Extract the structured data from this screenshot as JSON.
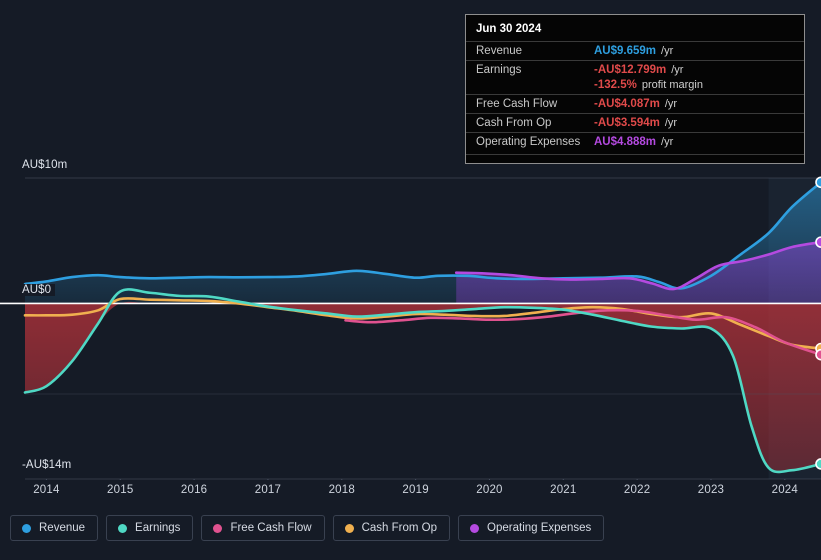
{
  "chart_data": {
    "type": "area",
    "title": "",
    "xlabel": "",
    "ylabel": "",
    "currency": "AU$",
    "y_axis": {
      "top_label": "AU$10m",
      "zero_label": "AU$0",
      "bottom_label": "-AU$14m",
      "ylim": [
        -14,
        10
      ],
      "gridlines": [
        10,
        0,
        -14
      ]
    },
    "x_axis": {
      "ticks": [
        "2014",
        "2015",
        "2016",
        "2017",
        "2018",
        "2019",
        "2020",
        "2021",
        "2022",
        "2023",
        "2024"
      ],
      "xlim": [
        2013.71,
        2024.49
      ]
    },
    "legend_position": "bottom-left",
    "grid": true,
    "forecast_boundary_year": 2023.78,
    "series": [
      {
        "name": "Revenue",
        "color": "#2e9fe0",
        "fill": "#1d4a66",
        "x": [
          2013.71,
          2014.0,
          2014.35,
          2014.7,
          2015.0,
          2015.4,
          2015.8,
          2016.2,
          2016.6,
          2017.0,
          2017.4,
          2017.8,
          2018.2,
          2018.6,
          2019.0,
          2019.3,
          2019.7,
          2020.1,
          2020.5,
          2021.0,
          2021.5,
          2022.0,
          2022.3,
          2022.6,
          2023.0,
          2023.4,
          2023.78,
          2024.1,
          2024.49
        ],
        "values": [
          1.55,
          1.75,
          2.1,
          2.25,
          2.1,
          2.0,
          2.05,
          2.1,
          2.08,
          2.1,
          2.15,
          2.35,
          2.6,
          2.35,
          2.05,
          2.2,
          2.2,
          2.0,
          1.95,
          2.0,
          2.05,
          2.15,
          1.7,
          1.2,
          2.2,
          3.9,
          5.6,
          7.7,
          9.659
        ]
      },
      {
        "name": "Earnings",
        "color": "#4fd8c4",
        "fill": "#8a2b33",
        "x": [
          2013.71,
          2014.0,
          2014.35,
          2014.7,
          2015.0,
          2015.4,
          2015.8,
          2016.2,
          2016.6,
          2017.0,
          2017.4,
          2017.8,
          2018.2,
          2018.6,
          2019.0,
          2019.4,
          2019.8,
          2020.2,
          2020.6,
          2021.0,
          2021.4,
          2021.8,
          2022.2,
          2022.6,
          2023.0,
          2023.3,
          2023.55,
          2023.78,
          2024.1,
          2024.49
        ],
        "values": [
          -7.1,
          -6.6,
          -4.6,
          -1.6,
          0.95,
          0.85,
          0.6,
          0.55,
          0.15,
          -0.25,
          -0.55,
          -0.8,
          -1.05,
          -0.9,
          -0.7,
          -0.6,
          -0.45,
          -0.3,
          -0.35,
          -0.5,
          -0.9,
          -1.4,
          -1.85,
          -2.0,
          -2.0,
          -4.2,
          -9.8,
          -13.1,
          -13.3,
          -12.799
        ]
      },
      {
        "name": "Free Cash Flow",
        "color": "#e0528f",
        "fill": "transparent",
        "x": [
          2018.05,
          2018.4,
          2018.8,
          2019.2,
          2019.6,
          2020.0,
          2020.4,
          2020.8,
          2021.2,
          2021.6,
          2022.0,
          2022.4,
          2022.8,
          2023.2,
          2023.6,
          2024.0,
          2024.49
        ],
        "values": [
          -1.35,
          -1.5,
          -1.35,
          -1.15,
          -1.2,
          -1.3,
          -1.25,
          -1.05,
          -0.75,
          -0.55,
          -0.6,
          -0.95,
          -1.3,
          -1.1,
          -1.9,
          -3.1,
          -4.087
        ]
      },
      {
        "name": "Cash From Op",
        "color": "#f0b04f",
        "fill": "transparent",
        "x": [
          2013.71,
          2014.0,
          2014.35,
          2014.7,
          2015.0,
          2015.4,
          2015.8,
          2016.2,
          2016.6,
          2017.0,
          2017.4,
          2017.8,
          2018.2,
          2018.6,
          2019.0,
          2019.4,
          2019.8,
          2020.2,
          2020.6,
          2021.0,
          2021.4,
          2021.8,
          2022.2,
          2022.6,
          2023.0,
          2023.4,
          2023.78,
          2024.1,
          2024.49
        ],
        "values": [
          -0.95,
          -0.95,
          -0.9,
          -0.55,
          0.35,
          0.3,
          0.25,
          0.2,
          0.0,
          -0.3,
          -0.6,
          -0.95,
          -1.2,
          -1.05,
          -0.85,
          -0.9,
          -1.0,
          -1.0,
          -0.75,
          -0.45,
          -0.3,
          -0.45,
          -0.85,
          -1.1,
          -0.8,
          -1.7,
          -2.6,
          -3.3,
          -3.594
        ]
      },
      {
        "name": "Operating Expenses",
        "color": "#b44ae0",
        "fill": "#4b3580",
        "x": [
          2019.55,
          2019.9,
          2020.3,
          2020.7,
          2021.1,
          2021.5,
          2021.9,
          2022.2,
          2022.5,
          2022.8,
          2023.1,
          2023.45,
          2023.78,
          2024.1,
          2024.49
        ],
        "values": [
          2.45,
          2.4,
          2.25,
          2.0,
          1.9,
          1.95,
          2.0,
          1.6,
          1.15,
          2.0,
          3.0,
          3.4,
          3.9,
          4.5,
          4.888
        ]
      }
    ]
  },
  "tooltip": {
    "title": "Jun 30 2024",
    "rows": [
      {
        "key": "Revenue",
        "value": "AU$9.659m",
        "suffix": "/yr",
        "color": "#2e9fe0"
      },
      {
        "key": "Earnings",
        "value": "-AU$12.799m",
        "suffix": "/yr",
        "color": "#e04a4a"
      },
      {
        "key": "",
        "value": "-132.5%",
        "suffix": "profit margin",
        "color": "#e04a4a"
      },
      {
        "key": "Free Cash Flow",
        "value": "-AU$4.087m",
        "suffix": "/yr",
        "color": "#e04a4a"
      },
      {
        "key": "Cash From Op",
        "value": "-AU$3.594m",
        "suffix": "/yr",
        "color": "#e04a4a"
      },
      {
        "key": "Operating Expenses",
        "value": "AU$4.888m",
        "suffix": "/yr",
        "color": "#b44ae0"
      }
    ]
  },
  "legend": {
    "items": [
      {
        "label": "Revenue",
        "color": "#2e9fe0"
      },
      {
        "label": "Earnings",
        "color": "#4fd8c4"
      },
      {
        "label": "Free Cash Flow",
        "color": "#e0528f"
      },
      {
        "label": "Cash From Op",
        "color": "#f0b04f"
      },
      {
        "label": "Operating Expenses",
        "color": "#b44ae0"
      }
    ]
  },
  "colors": {
    "background": "#151b26",
    "zero_line": "#ffffff",
    "gridline": "#4a5263",
    "negative_band": "#8a2b33",
    "forecast_band": "#1b2433"
  }
}
